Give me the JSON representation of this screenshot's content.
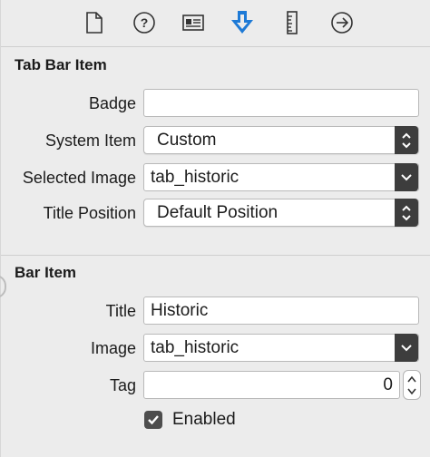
{
  "toolbar": {
    "icons": [
      "file-icon",
      "help-icon",
      "identity-icon",
      "attributes-icon",
      "size-icon",
      "connections-icon"
    ]
  },
  "tab_bar_item": {
    "title": "Tab Bar Item",
    "badge_label": "Badge",
    "badge_value": "",
    "system_item_label": "System Item",
    "system_item_value": "Custom",
    "selected_image_label": "Selected Image",
    "selected_image_value": "tab_historic",
    "title_position_label": "Title Position",
    "title_position_value": "Default Position"
  },
  "bar_item": {
    "title": "Bar Item",
    "title_label": "Title",
    "title_value": "Historic",
    "image_label": "Image",
    "image_value": "tab_historic",
    "tag_label": "Tag",
    "tag_value": "0",
    "enabled_label": "Enabled",
    "enabled_checked": true
  },
  "colors": {
    "accent": "#1e7ad6",
    "panel_bg": "#ececec",
    "arrow_bg": "#3d3d3d"
  }
}
